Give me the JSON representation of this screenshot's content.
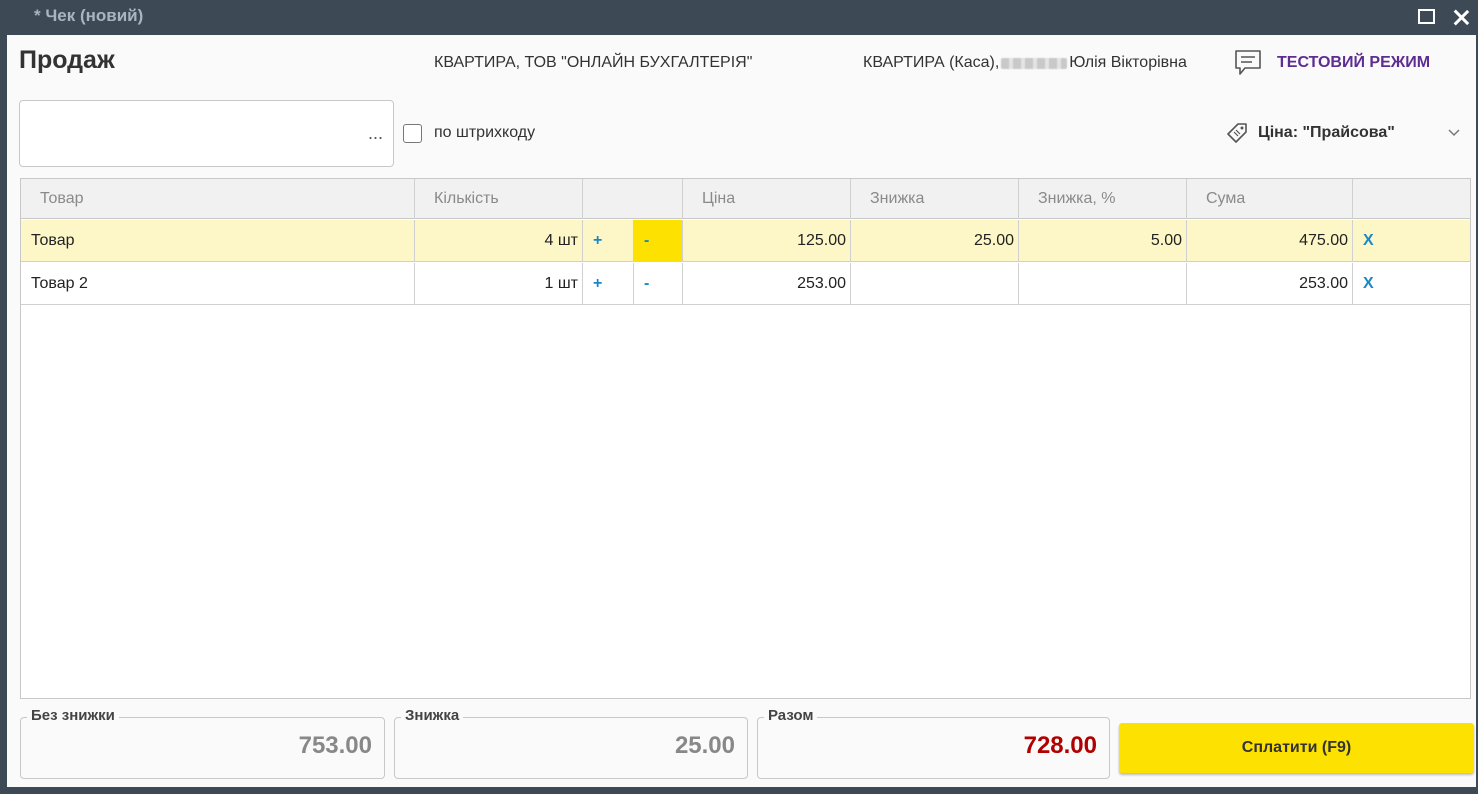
{
  "window": {
    "title": "* Чек (новий)"
  },
  "header": {
    "page_title": "Продаж",
    "organization": "КВАРТИРА, ТОВ \"ОНЛАЙН БУХГАЛТЕРІЯ\"",
    "cashier_prefix": "КВАРТИРА (Каса),",
    "cashier_name": "Юлія Вікторівна",
    "test_mode": "ТЕСТОВИЙ РЕЖИМ"
  },
  "toolbar": {
    "search_value": "",
    "search_placeholder": "",
    "ellipsis": "...",
    "barcode_label": "по штрихкоду",
    "barcode_checked": false,
    "price_type": "Ціна: \"Прайсова\""
  },
  "table": {
    "columns": [
      "Товар",
      "Кількість",
      "",
      "Ціна",
      "Знижка",
      "Знижка, %",
      "Сума",
      ""
    ],
    "rows": [
      {
        "product": "Товар",
        "qty": "4 шт",
        "plus": "+",
        "minus": "-",
        "price": "125.00",
        "discount": "25.00",
        "discount_pct": "5.00",
        "sum": "475.00",
        "delete": "X"
      },
      {
        "product": "Товар 2",
        "qty": "1 шт",
        "plus": "+",
        "minus": "-",
        "price": "253.00",
        "discount": "",
        "discount_pct": "",
        "sum": "253.00",
        "delete": "X"
      }
    ]
  },
  "totals": {
    "without_discount_label": "Без знижки",
    "without_discount_value": "753.00",
    "discount_label": "Знижка",
    "discount_value": "25.00",
    "total_label": "Разом",
    "total_value": "728.00",
    "pay_button": "Сплатити (F9)"
  },
  "colors": {
    "accent_yellow": "#fde100",
    "test_mode_purple": "#5e2d91",
    "total_red": "#b00000",
    "link_blue": "#1a88c8",
    "selected_row": "#fdf7c8"
  }
}
